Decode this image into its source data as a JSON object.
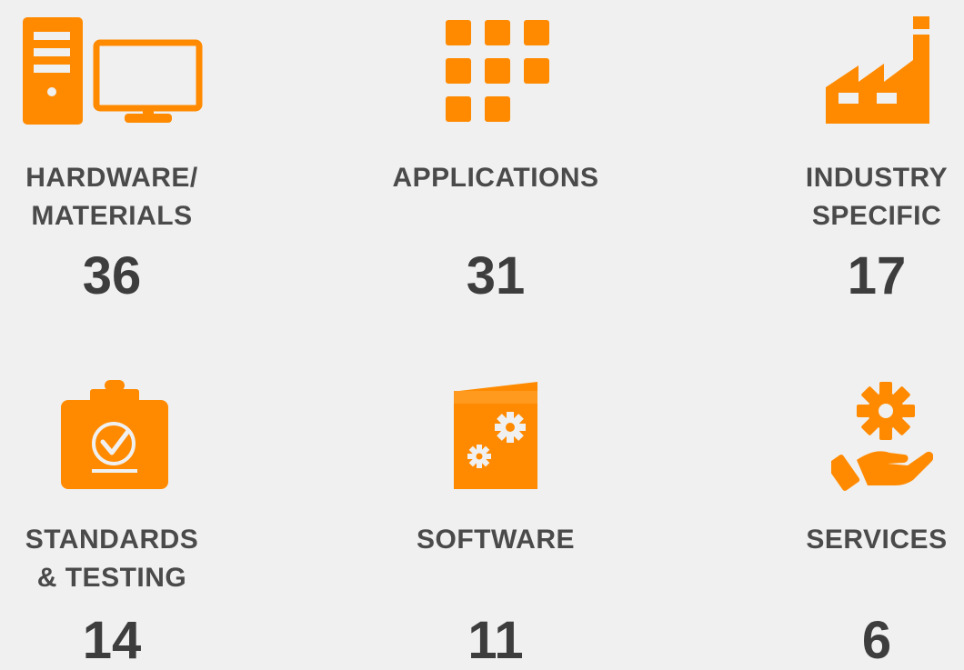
{
  "accent_color": "#ff8a00",
  "text_color": "#4a4a4a",
  "categories": [
    {
      "icon": "desktop-computer-icon",
      "label_line1": "HARDWARE/",
      "label_line2": "MATERIALS",
      "count": "36"
    },
    {
      "icon": "app-grid-icon",
      "label_line1": "APPLICATIONS",
      "label_line2": "",
      "count": "31"
    },
    {
      "icon": "factory-icon",
      "label_line1": "INDUSTRY",
      "label_line2": "SPECIFIC",
      "count": "17"
    },
    {
      "icon": "clipboard-check-icon",
      "label_line1": "STANDARDS",
      "label_line2": "& TESTING",
      "count": "14"
    },
    {
      "icon": "software-box-gears-icon",
      "label_line1": "SOFTWARE",
      "label_line2": "",
      "count": "11"
    },
    {
      "icon": "hand-gear-icon",
      "label_line1": "SERVICES",
      "label_line2": "",
      "count": "6"
    }
  ]
}
